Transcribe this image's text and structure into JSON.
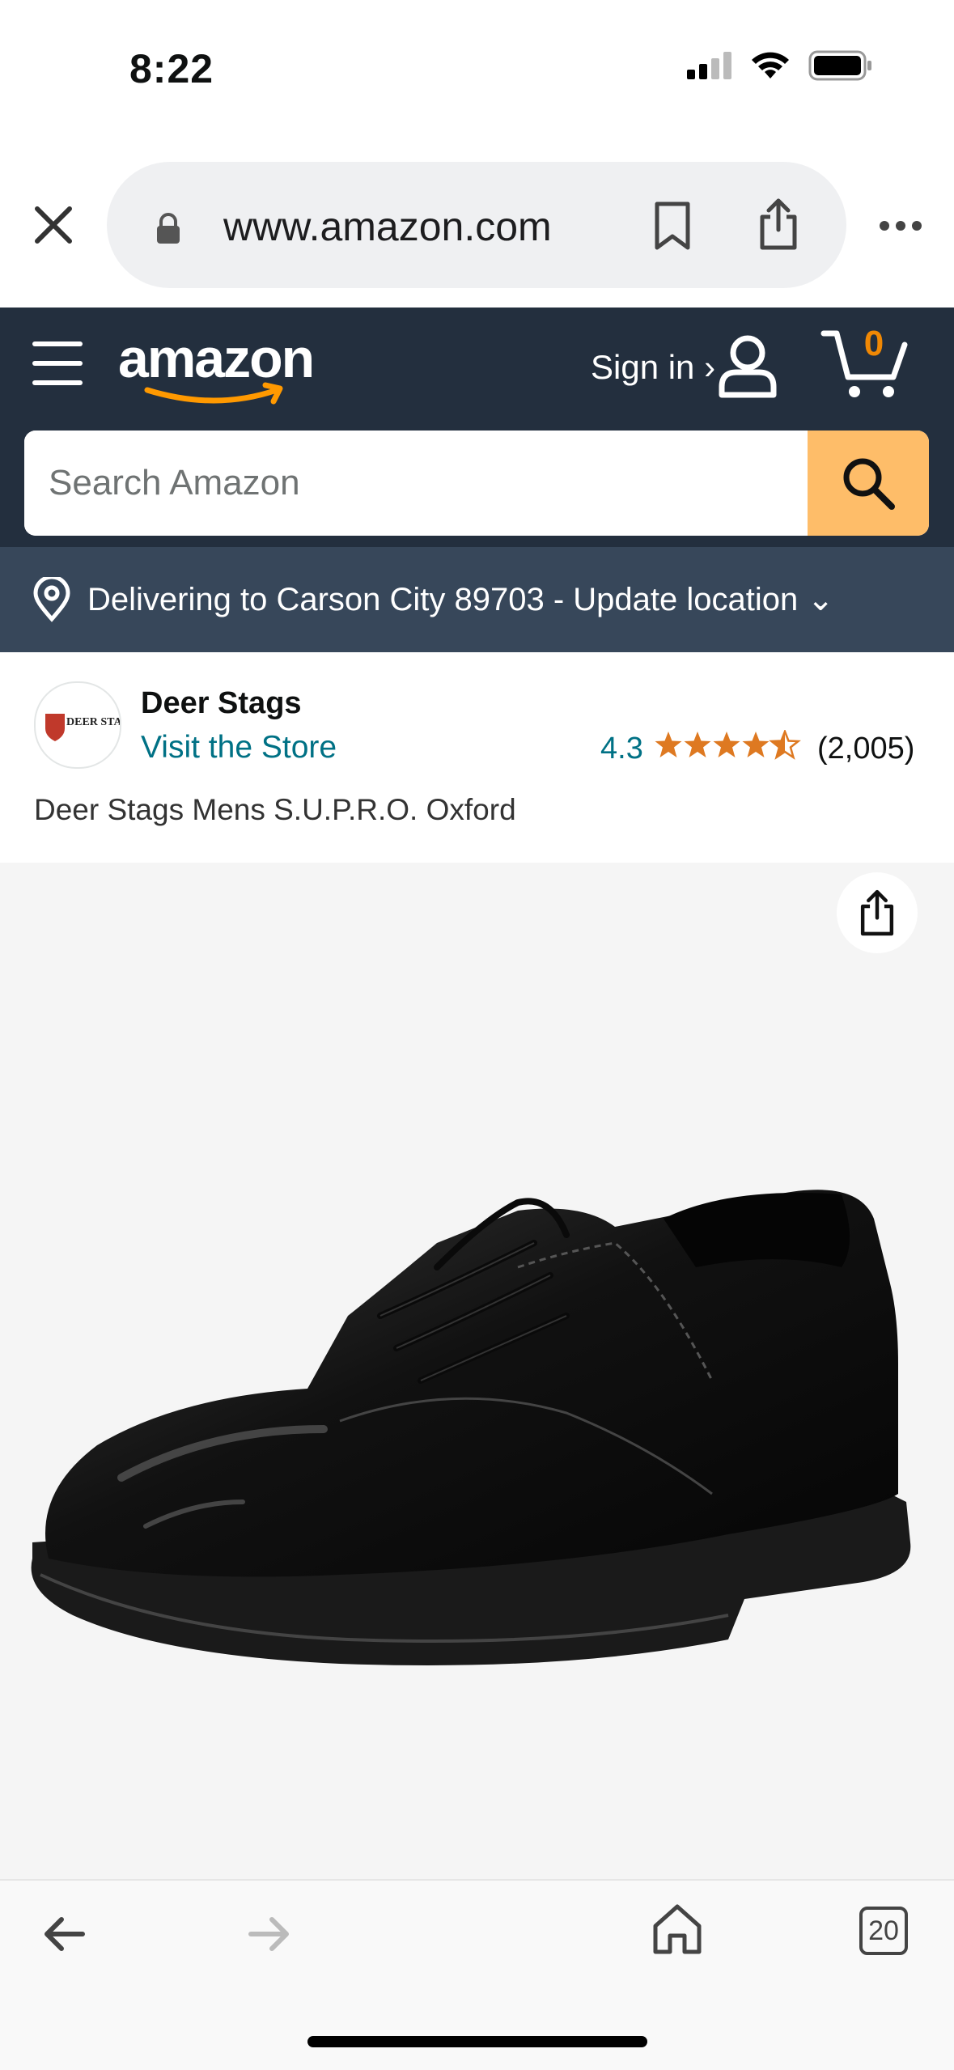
{
  "status": {
    "time": "8:22"
  },
  "browser": {
    "url": "www.amazon.com",
    "open_tabs": "20"
  },
  "header": {
    "logo_text": "amazon",
    "signin_label": "Sign in ›",
    "cart_count": "0",
    "search_placeholder": "Search Amazon"
  },
  "delivery": {
    "text": "Delivering to Carson City 89703 - Update location ⌄"
  },
  "product": {
    "brand_logo_text": "DEER STAGS",
    "brand": "Deer Stags",
    "visit_store": "Visit the Store",
    "rating": "4.3",
    "rating_count": "(2,005)",
    "title": "Deer Stags Mens S.U.P.R.O. Oxford"
  },
  "colors": {
    "header_bg": "#232f3e",
    "delivery_bg": "#37475a",
    "search_button": "#febd69",
    "link": "#007185",
    "star": "#de7921",
    "cart_count": "#f08804"
  },
  "icons": [
    "close-icon",
    "lock-icon",
    "bookmark-icon",
    "share-icon",
    "more-icon",
    "menu-icon",
    "account-icon",
    "cart-icon",
    "search-icon",
    "location-pin-icon",
    "star-icon",
    "back-icon",
    "forward-icon",
    "home-icon",
    "tabs-icon"
  ]
}
